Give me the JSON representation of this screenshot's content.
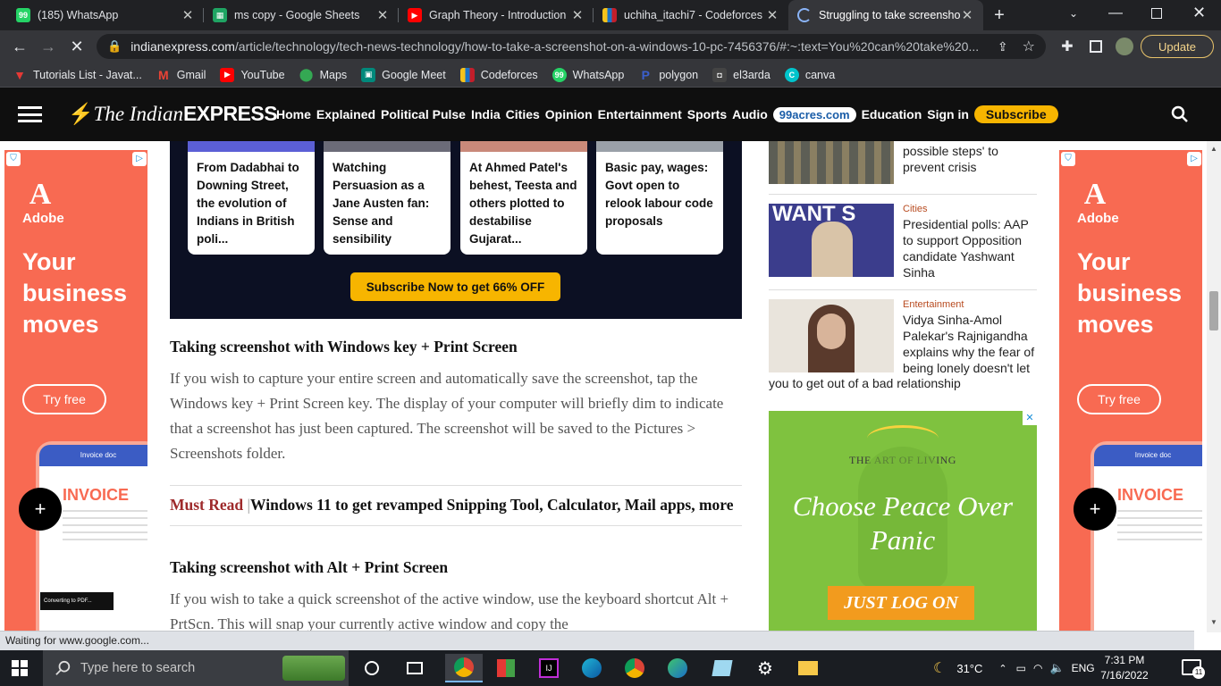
{
  "browser": {
    "tabs": [
      {
        "title": "(185) WhatsApp",
        "icon": "whatsapp-icon",
        "active": false
      },
      {
        "title": "ms copy - Google Sheets",
        "icon": "sheets-icon",
        "active": false
      },
      {
        "title": "Graph Theory - Introduction",
        "icon": "youtube-icon",
        "active": false
      },
      {
        "title": "uchiha_itachi7 - Codeforces",
        "icon": "codeforces-icon",
        "active": false
      },
      {
        "title": "Struggling to take screensho",
        "icon": "loading-icon",
        "active": true
      }
    ],
    "url_host": "indianexpress.com",
    "url_path": "/article/technology/tech-news-technology/how-to-take-a-screenshot-on-a-windows-10-pc-7456376/#:~:text=You%20can%20take%20...",
    "update_label": "Update",
    "bookmarks": [
      {
        "label": "Tutorials List - Javat...",
        "icon": "javatpoint-icon"
      },
      {
        "label": "Gmail",
        "icon": "gmail-icon"
      },
      {
        "label": "YouTube",
        "icon": "youtube-icon"
      },
      {
        "label": "Maps",
        "icon": "maps-icon"
      },
      {
        "label": "Google Meet",
        "icon": "meet-icon"
      },
      {
        "label": "Codeforces",
        "icon": "codeforces-icon"
      },
      {
        "label": "WhatsApp",
        "icon": "whatsapp-icon"
      },
      {
        "label": "polygon",
        "icon": "polygon-icon"
      },
      {
        "label": "el3arda",
        "icon": "el3arda-icon"
      },
      {
        "label": "canva",
        "icon": "canva-icon"
      }
    ],
    "status_text": "Waiting for www.google.com..."
  },
  "site": {
    "logo_the": "The Indian",
    "logo_express": "EXPRESS",
    "nav": [
      "Home",
      "Explained",
      "Political Pulse",
      "India",
      "Cities",
      "Opinion",
      "Entertainment",
      "Sports",
      "Audio"
    ],
    "acres": "99acres.com",
    "nav_after": [
      "Education",
      "Sign in"
    ],
    "subscribe": "Subscribe"
  },
  "promo": {
    "cards": [
      "From Dadabhai to Downing Street, the evolution of Indians in British poli...",
      "Watching Persuasion as a Jane Austen fan: Sense and sensibility",
      "At Ahmed Patel's behest, Teesta and others plotted to destabilise Gujarat...",
      "Basic pay, wages: Govt open to relook labour code proposals"
    ],
    "button": "Subscribe Now to get 66% OFF"
  },
  "article": {
    "h1": "Taking screenshot with Windows key + Print Screen",
    "p1": "If you wish to capture your entire screen and automatically save the screenshot, tap the Windows key + Print Screen key. The display of your computer will briefly dim to indicate that a screenshot has just been captured. The screenshot will be saved to the Pictures > Screenshots folder.",
    "must_read_label": "Must Read",
    "must_read_text": "Windows 11 to get revamped Snipping Tool, Calculator, Mail apps, more",
    "h2": "Taking screenshot with Alt + Print Screen",
    "p2": "If you wish to take a quick screenshot of the active window, use the keyboard shortcut Alt + PrtScn. This will snap your currently active window and copy the"
  },
  "sidebar": {
    "item0_title": "possible steps' to prevent crisis",
    "items": [
      {
        "category": "Cities",
        "title": "Presidential polls: AAP to support Opposition candidate Yashwant Sinha"
      },
      {
        "category": "Entertainment",
        "title": "Vidya Sinha-Amol Palekar's Rajnigandha explains why the fear of being lonely doesn't let you to get out of a bad relationship"
      }
    ],
    "img_text": "WANT S"
  },
  "ads": {
    "adobe_brand": "Adobe",
    "adobe_headline": "Your business moves",
    "adobe_cta": "Try free",
    "adobe_doc": "Invoice doc",
    "adobe_invoice": "INVOICE",
    "adobe_toast": "Converting to PDF...",
    "aol_brand": "THE ART OF LIVING",
    "aol_tagline": "Choose Peace Over Panic",
    "aol_cta": "JUST LOG ON"
  },
  "taskbar": {
    "search_placeholder": "Type here to search",
    "temperature": "31°C",
    "lang": "ENG",
    "time": "7:31 PM",
    "date": "7/16/2022",
    "notif_count": "11"
  },
  "colors": {
    "accent_yellow": "#f7b500",
    "brand_red": "#e8262b",
    "adobe_red": "#f86a52",
    "aol_green": "#7fc23f"
  }
}
